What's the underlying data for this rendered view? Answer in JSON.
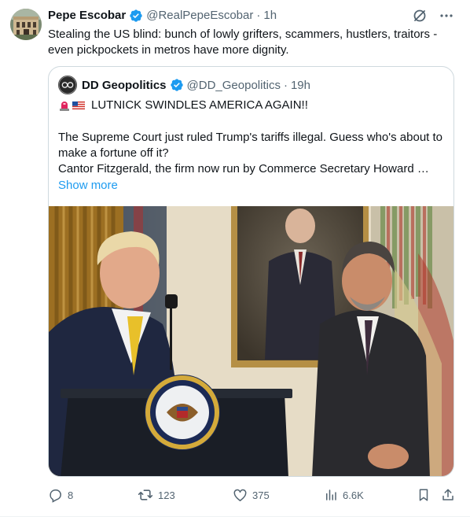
{
  "author": {
    "name": "Pepe Escobar",
    "handle": "@RealPepeEscobar",
    "separator": "·",
    "time": "1h"
  },
  "tweet": {
    "text": "Stealing the US blind: bunch of lowly grifters, scammers, hustlers, traitors - even pickpockets in metros have more dignity."
  },
  "quote": {
    "name": "DD Geopolitics",
    "handle": "@DD_Geopolitics",
    "separator": "·",
    "time": "19h",
    "headline": "LUTNICK SWINDLES AMERICA AGAIN!!",
    "headline_emojis": [
      "rotating-light-icon",
      "us-flag-icon"
    ],
    "line1": "The Supreme Court just ruled Trump's tariffs illegal. Guess who's about to",
    "line2": "make a fortune off it?",
    "line3": "Cantor Fitzgerald, the firm now run by Commerce Secretary Howard …",
    "show_more": "Show more"
  },
  "actions": {
    "replies": "8",
    "reposts": "123",
    "likes": "375",
    "views": "6.6K"
  },
  "icons": [
    "verified-badge-icon",
    "grok-icon",
    "more-icon",
    "reply-icon",
    "repost-icon",
    "like-icon",
    "views-icon",
    "bookmark-icon",
    "share-icon"
  ],
  "colors": {
    "accent": "#1d9bf0",
    "muted": "#536471",
    "text": "#0f1419",
    "border": "#cfd9de"
  }
}
